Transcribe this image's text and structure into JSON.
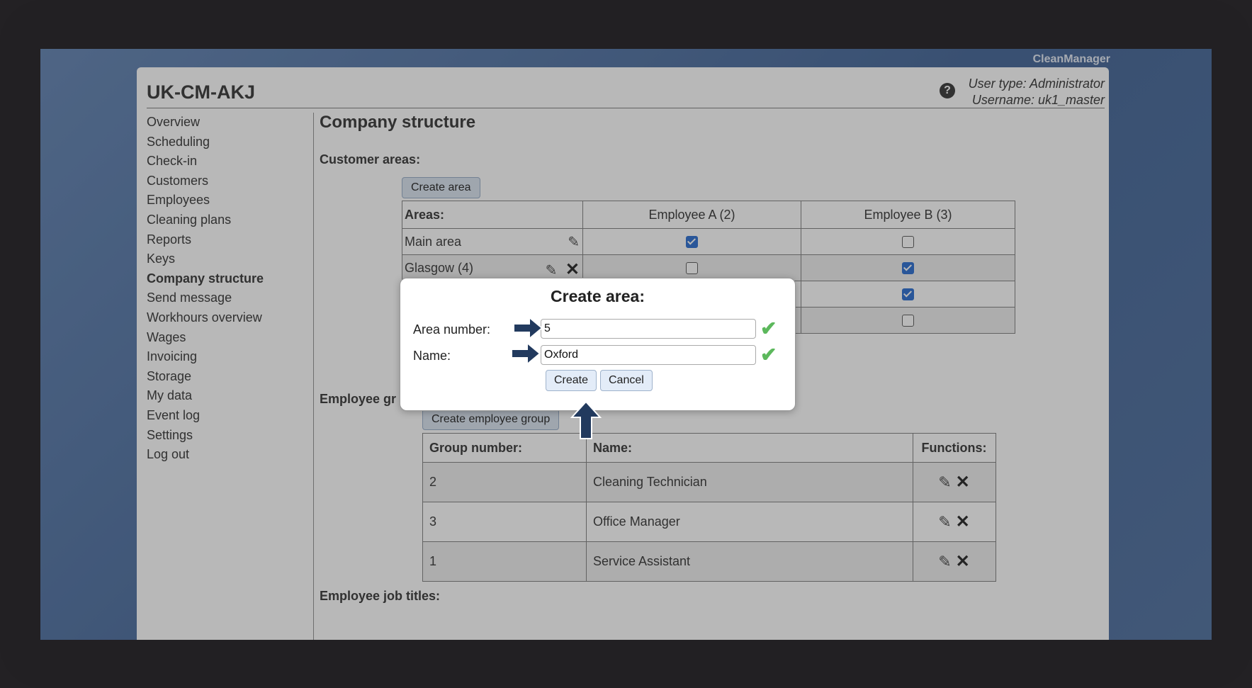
{
  "brand": "CleanManager",
  "header": {
    "title": "UK-CM-AKJ",
    "user_type": "User type: Administrator",
    "username": "Username: uk1_master",
    "help_glyph": "?"
  },
  "sidebar": {
    "items": [
      {
        "label": "Overview"
      },
      {
        "label": "Scheduling"
      },
      {
        "label": "Check-in"
      },
      {
        "label": "Customers"
      },
      {
        "label": "Employees"
      },
      {
        "label": "Cleaning plans"
      },
      {
        "label": "Reports"
      },
      {
        "label": "Keys"
      },
      {
        "label": "Company structure"
      },
      {
        "label": "Send message"
      },
      {
        "label": "Workhours overview"
      },
      {
        "label": "Wages"
      },
      {
        "label": "Invoicing"
      },
      {
        "label": "Storage"
      },
      {
        "label": "My data"
      },
      {
        "label": "Event log"
      },
      {
        "label": "Settings"
      },
      {
        "label": "Log out"
      }
    ]
  },
  "main": {
    "title": "Company structure",
    "customer_areas_label": "Customer areas:",
    "create_area_button": "Create area",
    "areas_table": {
      "headers": [
        "Areas:",
        "Employee A (2)",
        "Employee B (3)"
      ],
      "rows": [
        {
          "name": "Main area",
          "a": true,
          "b": false
        },
        {
          "name": "Glasgow (4)",
          "a": false,
          "b": true
        },
        {
          "name": "",
          "a": null,
          "b": true
        },
        {
          "name": "",
          "a": null,
          "b": false
        }
      ]
    },
    "employee_groups_label": "Employee gr",
    "create_group_button": "Create employee group",
    "groups_table": {
      "headers": [
        "Group number:",
        "Name:",
        "Functions:"
      ],
      "rows": [
        {
          "number": "2",
          "name": "Cleaning Technician"
        },
        {
          "number": "3",
          "name": "Office Manager"
        },
        {
          "number": "1",
          "name": "Service Assistant"
        }
      ]
    },
    "job_titles_label": "Employee job titles:"
  },
  "modal": {
    "title": "Create area:",
    "area_number_label": "Area number:",
    "area_number_value": "5",
    "name_label": "Name:",
    "name_value": "Oxford",
    "create_button": "Create",
    "cancel_button": "Cancel"
  },
  "colors": {
    "arrow": "#223a5e",
    "check": "#5cb85c",
    "checkbox_on": "#3a78d4"
  }
}
